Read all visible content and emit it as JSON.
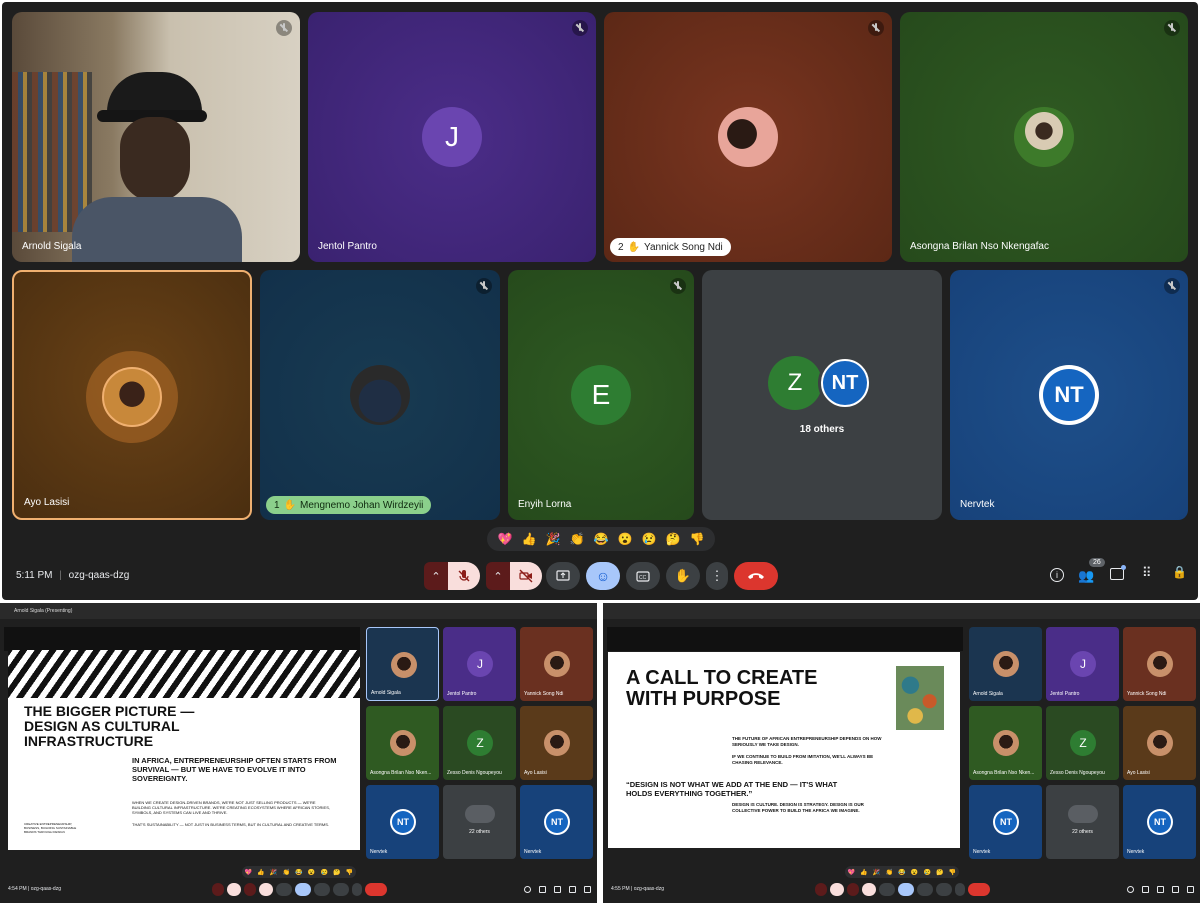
{
  "main": {
    "tiles": [
      {
        "name": "Arnold Sigala"
      },
      {
        "name": "Jentol Pantro",
        "initial": "J"
      },
      {
        "name": "Yannick Song Ndi",
        "hand_count": "2"
      },
      {
        "name": "Asongna Brilan Nso Nkengafac"
      },
      {
        "name": "Ayo Lasisi"
      },
      {
        "name": "Mengnemo Johan Wirdzeyii",
        "hand_count": "1"
      },
      {
        "name": "Enyih Lorna",
        "initial": "E"
      },
      {
        "name": "",
        "initial": "Z",
        "others": "18 others",
        "logo": "NT"
      },
      {
        "name": "Nervtek",
        "logo": "NT"
      }
    ],
    "reactions": [
      "💖",
      "👍",
      "🎉",
      "👏",
      "😂",
      "😮",
      "😢",
      "🤔",
      "👎"
    ],
    "time": "5:11 PM",
    "meeting_code": "ozg-qaas-dzg",
    "people_count": "26",
    "colors": {
      "accent": "#ea4335",
      "control": "#3c4043",
      "active_control": "#a8c7fa"
    }
  },
  "left_shot": {
    "presenting": "Arnold Sigala (Presenting)",
    "time": "4:54 PM",
    "meeting_code": "ozg-qaas-dzg",
    "slide": {
      "title": "THE BIGGER PICTURE — DESIGN AS CULTURAL INFRASTRUCTURE",
      "lead": "IN AFRICA, ENTREPRENEURSHIP OFTEN STARTS FROM SURVIVAL — BUT WE HAVE TO EVOLVE IT INTO SOVEREIGNTY.",
      "body": "WHEN WE CREATE DESIGN-DRIVEN BRANDS, WE'RE NOT JUST SELLING PRODUCTS — WE'RE BUILDING CULTURAL INFRASTRUCTURE. WE'RE CREATING ECOSYSTEMS WHERE AFRICAN STORIES, SYMBOLS, AND SYSTEMS CAN LIVE AND THRIVE.",
      "body2": "THAT'S SUSTAINABILITY — NOT JUST IN BUSINESS TERMS, BUT IN CULTURAL AND CREATIVE TERMS.",
      "side": "CREATIVE ENTREPRENEURSHIP, BUSINESS, BUILDING SUSTAINABLE BRANDS THROUGH DESIGN"
    },
    "tiles": [
      {
        "name": "Arnold Sigala"
      },
      {
        "name": "Jentol Pantro",
        "initial": "J"
      },
      {
        "name": "Yannick Song Ndi"
      },
      {
        "name": "Asongna Brilan Nso Nken..."
      },
      {
        "name": "Zesso Denis Ngoupeyou",
        "initial": "Z"
      },
      {
        "name": "Ayo Lasisi"
      },
      {
        "name": "Nervtek",
        "logo": "NT"
      },
      {
        "name": "",
        "others": "22 others"
      },
      {
        "name": "Nervtek",
        "logo": "NT"
      }
    ]
  },
  "right_shot": {
    "time": "4:55 PM",
    "meeting_code": "ozg-qaas-dzg",
    "slide": {
      "title": "A CALL TO CREATE WITH PURPOSE",
      "p1": "THE FUTURE OF AFRICAN ENTREPRENEURSHIP DEPENDS ON HOW SERIOUSLY WE TAKE DESIGN.",
      "p2": "IF WE CONTINUE TO BUILD FROM IMITATION, WE'LL ALWAYS BE CHASING RELEVANCE.",
      "quote": "“DESIGN IS NOT WHAT WE ADD AT THE END — IT'S WHAT HOLDS EVERYTHING TOGETHER.”",
      "p3": "DESIGN IS CULTURE. DESIGN IS STRATEGY. DESIGN IS OUR COLLECTIVE POWER TO BUILD THE AFRICA WE IMAGINE."
    },
    "tiles": [
      {
        "name": "Arnold Sigala"
      },
      {
        "name": "Jentol Pantro",
        "initial": "J"
      },
      {
        "name": "Yannick Song Ndi"
      },
      {
        "name": "Asongna Brilan Nso Nken..."
      },
      {
        "name": "Zesso Denis Ngoupeyou",
        "initial": "Z"
      },
      {
        "name": "Ayo Lasisi"
      },
      {
        "name": "Nervtek",
        "logo": "NT"
      },
      {
        "name": "",
        "others": "22 others"
      },
      {
        "name": "Nervtek",
        "logo": "NT"
      }
    ]
  }
}
